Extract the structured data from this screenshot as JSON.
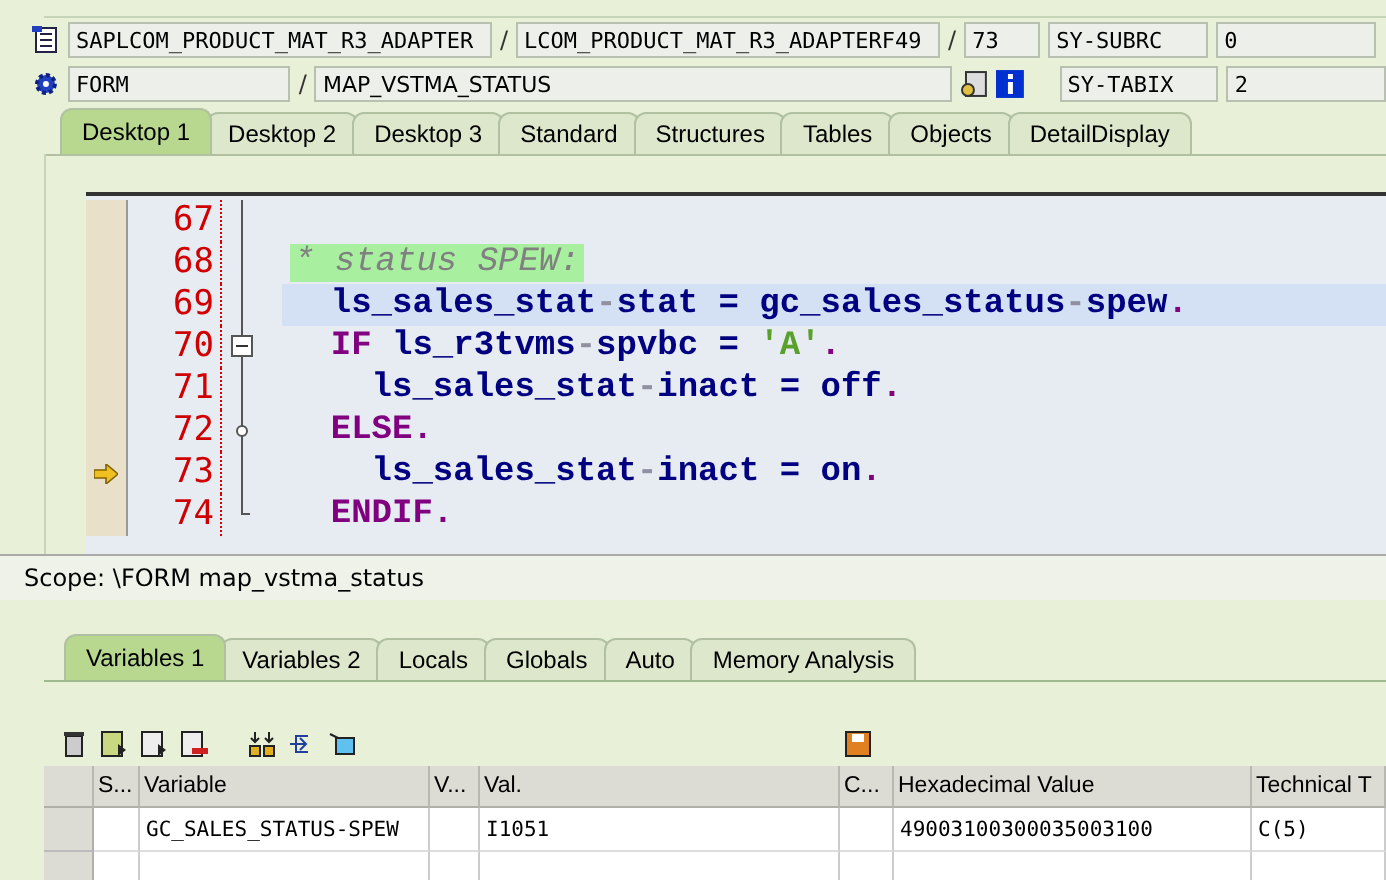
{
  "header": {
    "program": "SAPLCOM_PRODUCT_MAT_R3_ADAPTER",
    "include": "LCOM_PRODUCT_MAT_R3_ADAPTERF49",
    "line": "73",
    "event_type": "FORM",
    "event": "MAP_VSTMA_STATUS",
    "separators": [
      "/",
      "/",
      "/"
    ],
    "sysfields": [
      {
        "name": "SY-SUBRC",
        "value": "0"
      },
      {
        "name": "SY-TABIX",
        "value": "2"
      }
    ]
  },
  "tabs": [
    {
      "label": "Desktop 1",
      "selected": true
    },
    {
      "label": "Desktop 2",
      "selected": false
    },
    {
      "label": "Desktop 3",
      "selected": false
    },
    {
      "label": "Standard",
      "selected": false
    },
    {
      "label": "Structures",
      "selected": false
    },
    {
      "label": "Tables",
      "selected": false
    },
    {
      "label": "Objects",
      "selected": false
    },
    {
      "label": "DetailDisplay",
      "selected": false
    }
  ],
  "code": [
    {
      "number": "67",
      "current": false,
      "cursor_line": false,
      "kind": "line"
    },
    {
      "number": "68",
      "current": false,
      "cursor_line": false,
      "kind": "line",
      "segments": [
        {
          "kind": "comment",
          "text": "* status SPEW:"
        }
      ]
    },
    {
      "number": "69",
      "current": false,
      "cursor_line": true,
      "kind": "line",
      "segments": [
        {
          "kind": "id",
          "text": "  ls_sales_stat"
        },
        {
          "kind": "pun",
          "text": "-"
        },
        {
          "kind": "id",
          "text": "stat = gc_sales_status"
        },
        {
          "kind": "pun",
          "text": "-"
        },
        {
          "kind": "id",
          "text": "spew"
        },
        {
          "kind": "dot",
          "text": "."
        }
      ]
    },
    {
      "number": "70",
      "current": false,
      "cursor_line": false,
      "kind": "start",
      "segments": [
        {
          "kind": "kw",
          "text": "  IF"
        },
        {
          "kind": "id",
          "text": " ls_r3tvms"
        },
        {
          "kind": "pun",
          "text": "-"
        },
        {
          "kind": "id",
          "text": "spvbc = "
        },
        {
          "kind": "str",
          "text": "'A'"
        },
        {
          "kind": "dot",
          "text": "."
        }
      ]
    },
    {
      "number": "71",
      "current": false,
      "cursor_line": false,
      "kind": "line",
      "segments": [
        {
          "kind": "id",
          "text": "    ls_sales_stat"
        },
        {
          "kind": "pun",
          "text": "-"
        },
        {
          "kind": "id",
          "text": "inact = off"
        },
        {
          "kind": "dot",
          "text": "."
        }
      ]
    },
    {
      "number": "72",
      "current": false,
      "cursor_line": false,
      "kind": "mid",
      "segments": [
        {
          "kind": "kw",
          "text": "  ELSE."
        }
      ]
    },
    {
      "number": "73",
      "current": true,
      "cursor_line": false,
      "kind": "line",
      "segments": [
        {
          "kind": "id",
          "text": "    ls_sales_stat"
        },
        {
          "kind": "pun",
          "text": "-"
        },
        {
          "kind": "id",
          "text": "inact = on"
        },
        {
          "kind": "dot",
          "text": "."
        }
      ]
    },
    {
      "number": "74",
      "current": false,
      "cursor_line": false,
      "kind": "end",
      "segments": [
        {
          "kind": "kw",
          "text": "  ENDIF."
        }
      ]
    }
  ],
  "scope": "Scope: \\FORM map_vstma_status",
  "lower_tabs": [
    {
      "label": "Variables 1",
      "selected": true
    },
    {
      "label": "Variables 2",
      "selected": false
    },
    {
      "label": "Locals",
      "selected": false
    },
    {
      "label": "Globals",
      "selected": false
    },
    {
      "label": "Auto",
      "selected": false
    },
    {
      "label": "Memory Analysis",
      "selected": false
    }
  ],
  "table": {
    "columns": [
      "S...",
      "Variable",
      "V...",
      "Val.",
      "C...",
      "Hexadecimal Value",
      "Technical T"
    ],
    "rows": [
      [
        "",
        "GC_SALES_STATUS-SPEW",
        "",
        "I1051",
        "",
        "49003100300035003100",
        "C(5)"
      ],
      [
        "",
        "",
        "",
        "",
        "",
        "",
        ""
      ]
    ]
  }
}
